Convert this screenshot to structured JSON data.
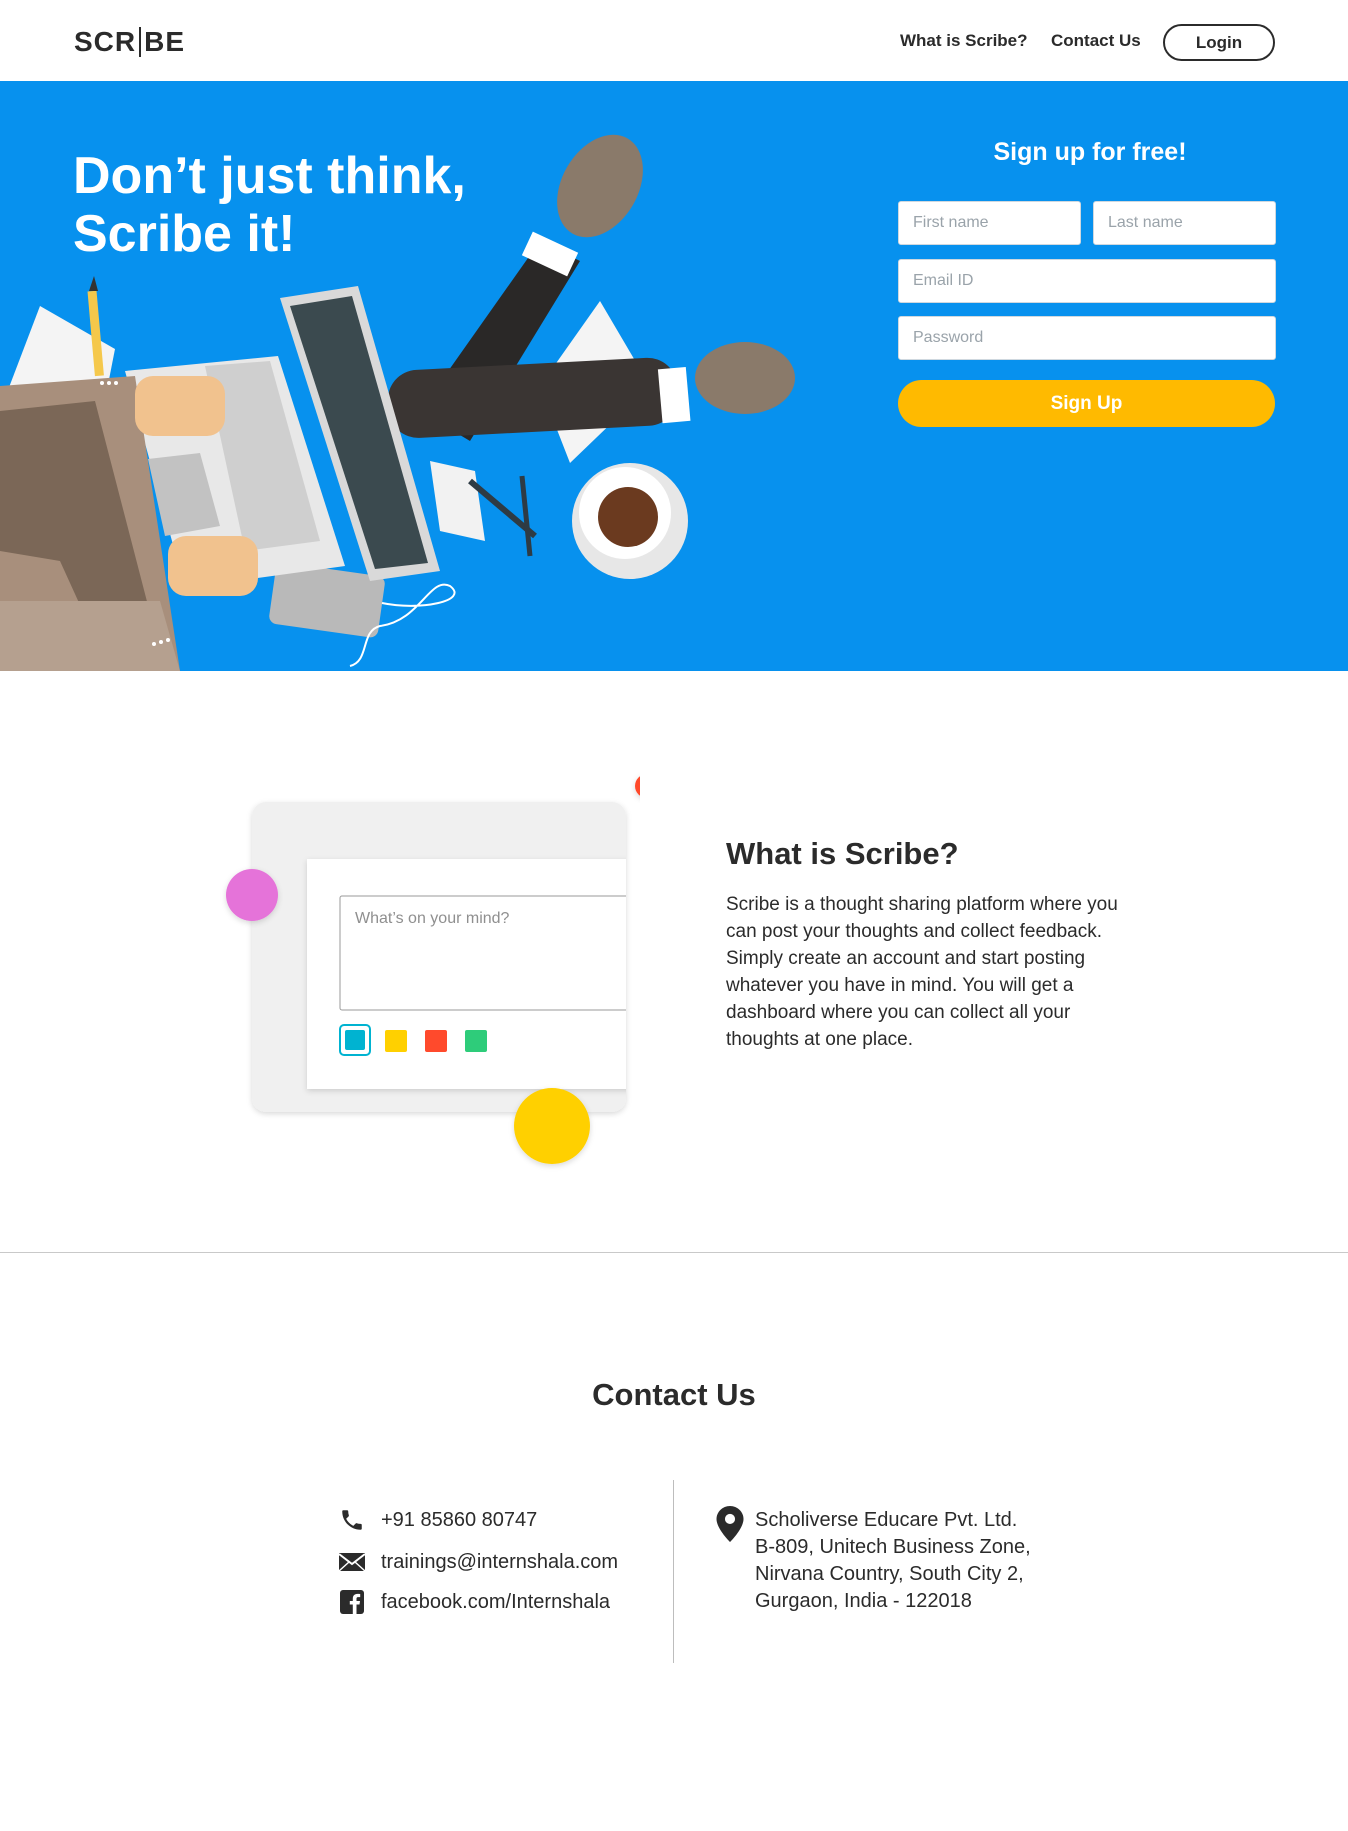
{
  "nav": {
    "logo_left": "SCR",
    "logo_right": "BE",
    "links": [
      {
        "label": "What is Scribe?"
      },
      {
        "label": "Contact Us"
      }
    ],
    "login_label": "Login"
  },
  "hero": {
    "title_line1": "Don’t just think,",
    "title_line2": "Scribe it!",
    "bg_color": "#0791ee"
  },
  "signup": {
    "title": "Sign up for free!",
    "first_name_placeholder": "First name",
    "last_name_placeholder": "Last name",
    "email_placeholder": "Email ID",
    "password_placeholder": "Password",
    "button_label": "Sign Up",
    "button_color": "#ffba00"
  },
  "what": {
    "title": "What is Scribe?",
    "body": "Scribe is a thought sharing platform where you can post your thoughts and collect feedback. Simply create an account and start posting whatever you have in mind. You will get a dashboard where you can collect all your thoughts at one place.",
    "mock_placeholder": "What’s on your mind?",
    "mock_colors": [
      "#00b3d1",
      "#ffd000",
      "#ff4a2c",
      "#2ecc7a"
    ]
  },
  "contact": {
    "title": "Contact Us",
    "phone": "+91 85860 80747",
    "email": "trainings@internshala.com",
    "facebook": "facebook.com/Internshala",
    "address_lines": [
      "Scholiverse Educare Pvt. Ltd.",
      "B-809, Unitech Business Zone,",
      "Nirvana Country, South City 2,",
      "Gurgaon, India - 122018"
    ]
  }
}
